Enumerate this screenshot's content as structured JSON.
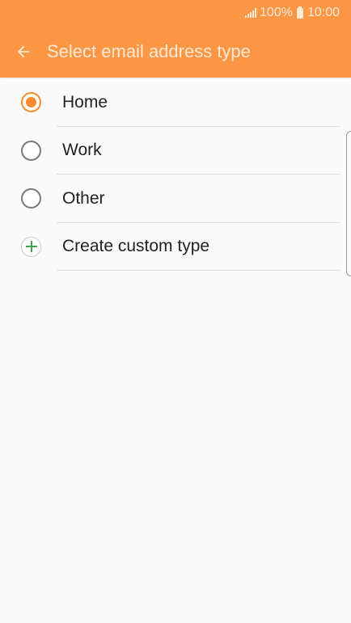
{
  "status_bar": {
    "battery_text": "100%",
    "time": "10:00"
  },
  "app_bar": {
    "title": "Select email address type",
    "back_icon": "arrow-left-icon"
  },
  "options": [
    {
      "label": "Home",
      "selected": true
    },
    {
      "label": "Work",
      "selected": false
    },
    {
      "label": "Other",
      "selected": false
    },
    {
      "label": "Create custom type",
      "icon": "plus-circle-icon"
    }
  ],
  "colors": {
    "accent": "#fb9644",
    "radio_selected": "#fb8c2c",
    "plus_green": "#3fa34d"
  }
}
